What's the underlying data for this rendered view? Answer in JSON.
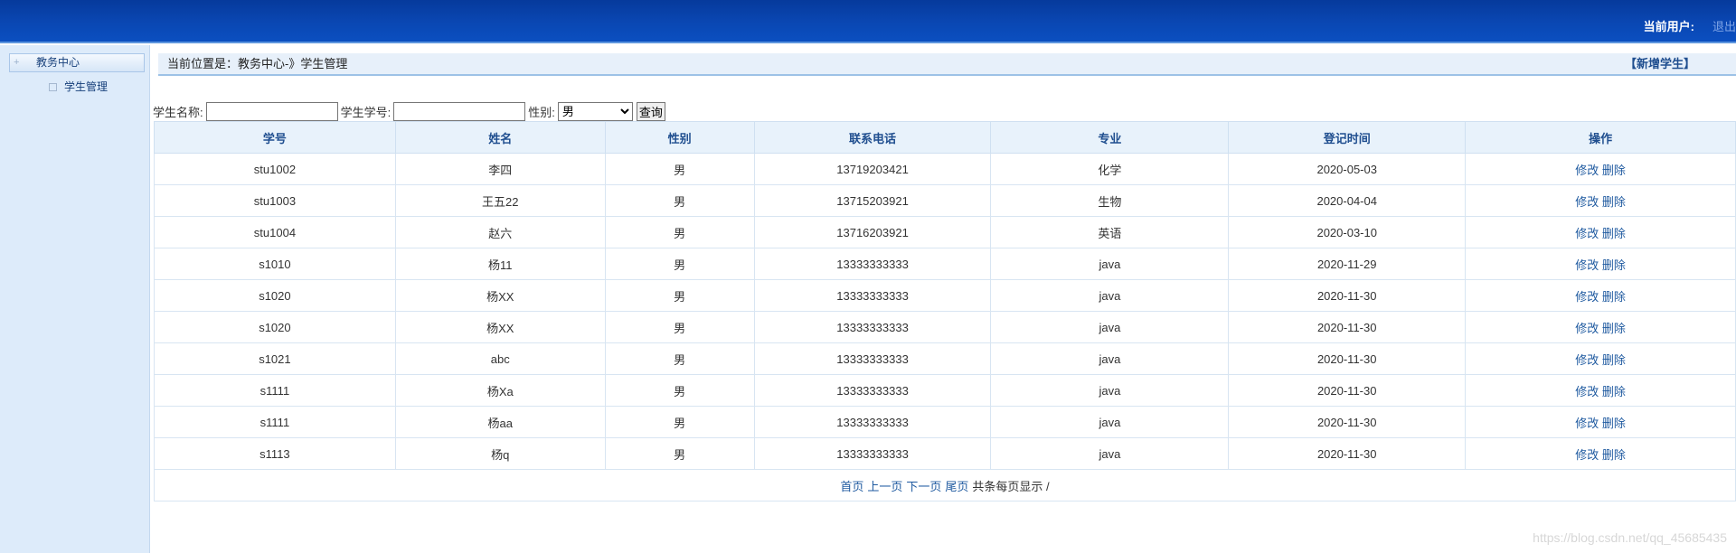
{
  "header": {
    "current_user_label": "当前用户:",
    "logout_label": "退出"
  },
  "sidebar": {
    "section_label": "教务中心",
    "items": [
      {
        "label": "学生管理"
      }
    ]
  },
  "breadcrumb": {
    "text": "当前位置是：教务中心-》学生管理",
    "add_label": "【新增学生】"
  },
  "search": {
    "name_label": "学生名称:",
    "name_value": "",
    "number_label": "学生学号:",
    "number_value": "",
    "gender_label": "性别:",
    "gender_selected": "男",
    "query_label": "查询"
  },
  "table": {
    "columns": [
      "学号",
      "姓名",
      "性别",
      "联系电话",
      "专业",
      "登记时间",
      "操作"
    ],
    "edit_label": "修改",
    "delete_label": "删除",
    "rows": [
      {
        "id": "stu1002",
        "name": "李四",
        "gender": "男",
        "phone": "13719203421",
        "major": "化学",
        "date": "2020-05-03"
      },
      {
        "id": "stu1003",
        "name": "王五22",
        "gender": "男",
        "phone": "13715203921",
        "major": "生物",
        "date": "2020-04-04"
      },
      {
        "id": "stu1004",
        "name": "赵六",
        "gender": "男",
        "phone": "13716203921",
        "major": "英语",
        "date": "2020-03-10"
      },
      {
        "id": "s1010",
        "name": "杨11",
        "gender": "男",
        "phone": "13333333333",
        "major": "java",
        "date": "2020-11-29"
      },
      {
        "id": "s1020",
        "name": "杨XX",
        "gender": "男",
        "phone": "13333333333",
        "major": "java",
        "date": "2020-11-30"
      },
      {
        "id": "s1020",
        "name": "杨XX",
        "gender": "男",
        "phone": "13333333333",
        "major": "java",
        "date": "2020-11-30"
      },
      {
        "id": "s1021",
        "name": "abc",
        "gender": "男",
        "phone": "13333333333",
        "major": "java",
        "date": "2020-11-30"
      },
      {
        "id": "s1111",
        "name": "杨Xa",
        "gender": "男",
        "phone": "13333333333",
        "major": "java",
        "date": "2020-11-30"
      },
      {
        "id": "s1111",
        "name": "杨aa",
        "gender": "男",
        "phone": "13333333333",
        "major": "java",
        "date": "2020-11-30"
      },
      {
        "id": "s1113",
        "name": "杨q",
        "gender": "男",
        "phone": "13333333333",
        "major": "java",
        "date": "2020-11-30"
      }
    ]
  },
  "pager": {
    "first": "首页",
    "prev": "上一页",
    "next": "下一页",
    "last": "尾页",
    "info": "共条每页显示 /"
  },
  "watermark": "https://blog.csdn.net/qq_45685435"
}
